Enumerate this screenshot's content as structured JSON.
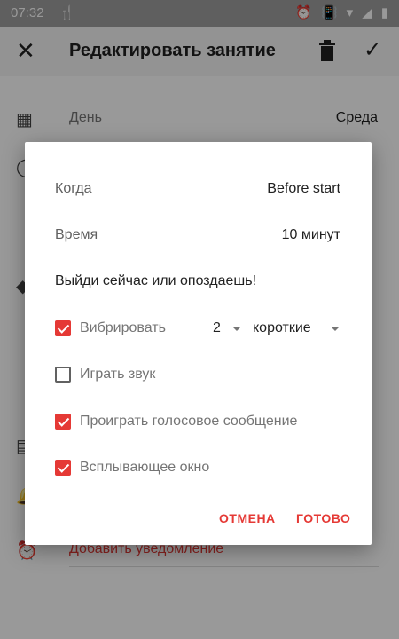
{
  "status_bar": {
    "time": "07:32"
  },
  "app_bar": {
    "title": "Редактировать занятие"
  },
  "background": {
    "day_label": "День",
    "day_value": "Среда",
    "add_notification": "Добавить уведомление"
  },
  "dialog": {
    "when_label": "Когда",
    "when_value": "Before start",
    "time_label": "Время",
    "time_value": "10 минут",
    "message": "Выйди сейчас или опоздаешь!",
    "vibrate_label": "Вибрировать",
    "vibrate_count": "2",
    "vibrate_type": "короткие",
    "play_sound_label": "Играть звук",
    "voice_message_label": "Проиграть голосовое сообщение",
    "popup_label": "Всплывающее окно",
    "checks": {
      "vibrate": true,
      "play_sound": false,
      "voice_message": true,
      "popup": true
    },
    "cancel": "ОТМЕНА",
    "done": "ГОТОВО"
  },
  "colors": {
    "accent": "#e53935",
    "scrim": "rgba(0,0,0,0.40)"
  }
}
